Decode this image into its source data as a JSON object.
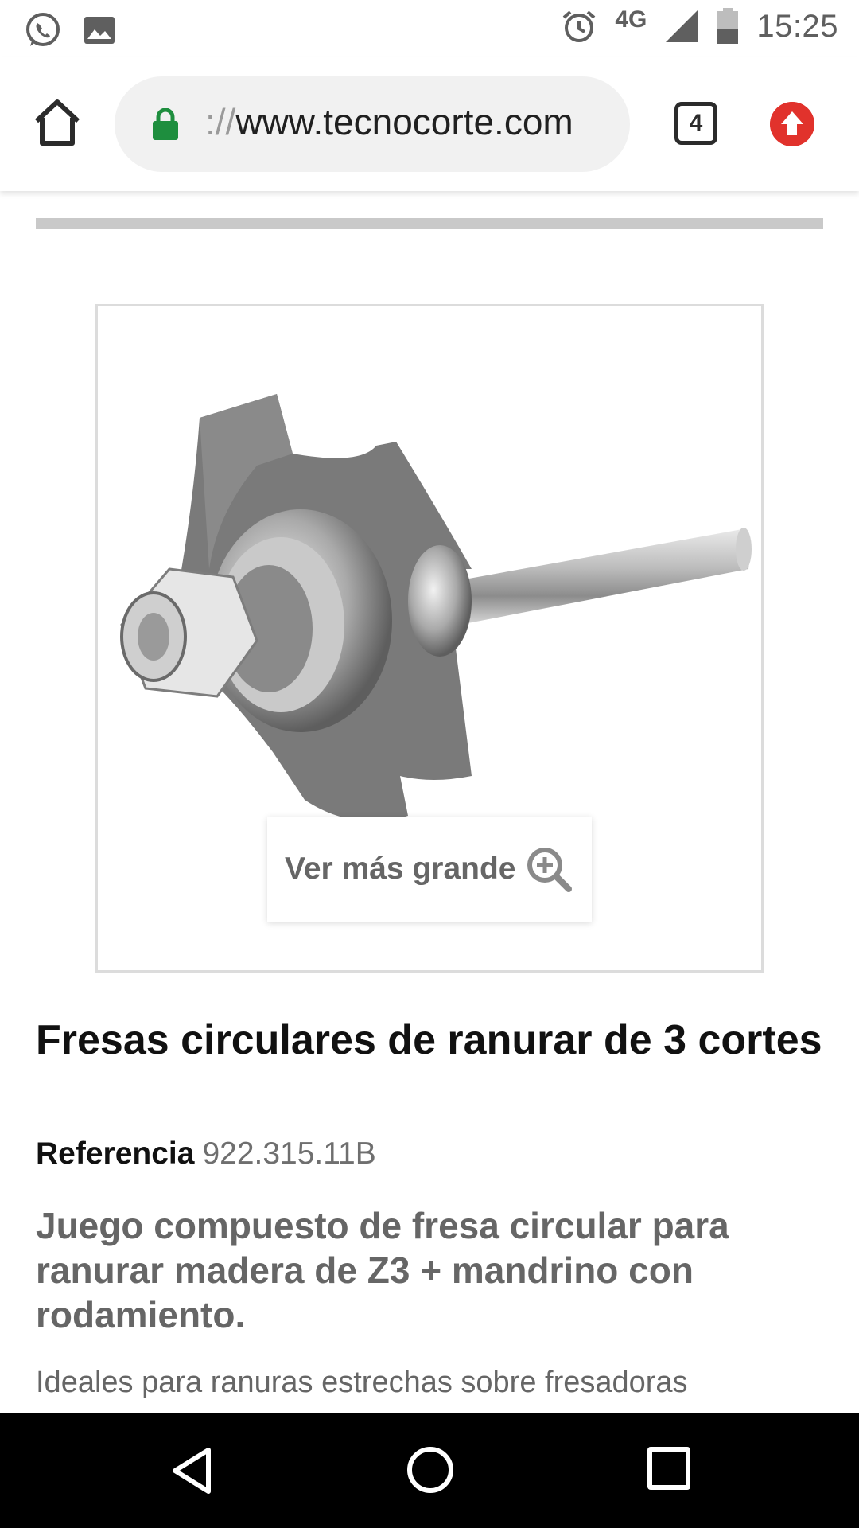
{
  "status_bar": {
    "time": "15:25",
    "network": "4G",
    "icons": [
      "whatsapp-icon",
      "image-icon",
      "alarm-icon",
      "signal-icon",
      "battery-icon"
    ]
  },
  "browser": {
    "url_prefix": "://",
    "url_host": "www.tecnocorte.com",
    "tab_count": "4",
    "icons": [
      "home-icon",
      "lock-icon",
      "update-icon"
    ],
    "lock_color": "#1e8e3e",
    "update_color": "#e1322c"
  },
  "product": {
    "zoom_label": "Ver más grande",
    "title": "Fresas circulares de ranurar de 3 cortes",
    "reference_label": "Referencia",
    "reference_value": "922.315.11B",
    "subtitle": "Juego compuesto de fresa circular para ranurar madera de Z3 + mandrino con rodamiento.",
    "description": "Ideales para ranuras estrechas sobre fresadoras portátiles."
  },
  "navigation": {
    "icons": [
      "back-icon",
      "home-circle-icon",
      "recents-icon"
    ]
  }
}
